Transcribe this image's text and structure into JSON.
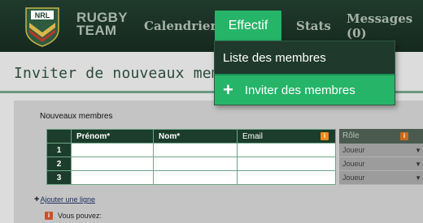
{
  "nav": {
    "brand_line1": "RUGBY",
    "brand_line2": "TEAM",
    "logo_text": "NRL",
    "items": [
      {
        "label": "Calendrier"
      },
      {
        "label": "Effectif"
      },
      {
        "label": "Stats"
      },
      {
        "label": "Messages (0)"
      }
    ]
  },
  "dropdown": {
    "items": [
      {
        "label": "Liste des membres"
      },
      {
        "label": "Inviter des membres",
        "icon": "plus-icon"
      }
    ]
  },
  "page": {
    "title": "Inviter de nouveaux membres",
    "section_label": "Nouveaux membres",
    "add_line_label": "Ajouter une ligne",
    "hint_text": "Vous pouvez:"
  },
  "table": {
    "headers": [
      "Prénom*",
      "Nom*",
      "Email",
      "Rôle"
    ],
    "rows": [
      {
        "index": "1",
        "prenom": "",
        "nom": "",
        "email": "",
        "role": "Joueur"
      },
      {
        "index": "2",
        "prenom": "",
        "nom": "",
        "email": "",
        "role": "Joueur"
      },
      {
        "index": "3",
        "prenom": "",
        "nom": "",
        "email": "",
        "role": "Joueur"
      }
    ]
  },
  "colors": {
    "accent": "#26b469",
    "nav_bg": "#1f3a2c",
    "info_badge": "#f08a1c"
  }
}
